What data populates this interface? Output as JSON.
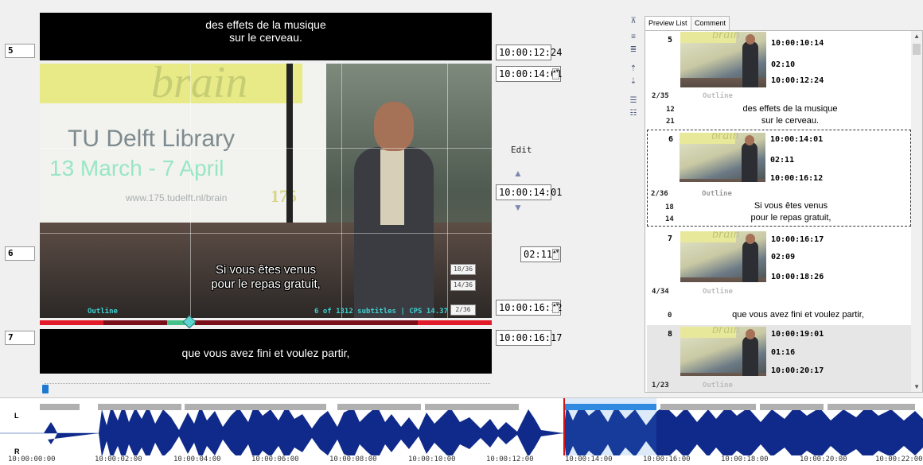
{
  "editor": {
    "prev": {
      "number": "5",
      "line1": "des effets de la musique",
      "line2": "sur le cerveau.",
      "end": "10:00:12:24"
    },
    "current": {
      "number": "6",
      "start": "10:00:14:01",
      "start_mid": "10:00:14:01",
      "duration": "02:11",
      "end": "10:00:16:12",
      "line1": "Si vous êtes venus",
      "line2": "pour le repas gratuit,"
    },
    "next": {
      "number": "7",
      "line1": "que vous avez fini et voulez partir,",
      "start": "10:00:16:17"
    },
    "edit_label": "Edit",
    "arrow_up": "▲",
    "arrow_down": "▼"
  },
  "video": {
    "slide_brain": "brain",
    "slide_library": "TU Delft Library",
    "slide_dates": "13 March - 7 April",
    "slide_url": "www.175.tudelft.nl/brain",
    "slide_logo": "175",
    "badge1": "18/36",
    "badge2": "14/36",
    "badge3": "2/36",
    "status_outline": "Outline",
    "status_count": "6 of 1312 subtitles | CPS 14.37"
  },
  "right_panel": {
    "tabs": [
      "Preview List",
      "Comment"
    ],
    "items": [
      {
        "number": "5",
        "start": "10:00:10:14",
        "duration": "02:10",
        "end": "10:00:12:24",
        "ratio": "2/35",
        "outline": "Outline",
        "c1": "12",
        "c2": "21",
        "line1": "des effets de la musique",
        "line2": "sur le cerveau."
      },
      {
        "number": "6",
        "start": "10:00:14:01",
        "duration": "02:11",
        "end": "10:00:16:12",
        "ratio": "2/36",
        "outline": "Outline",
        "c1": "18",
        "c2": "14",
        "line1": "Si vous êtes venus",
        "line2": "pour le repas gratuit,"
      },
      {
        "number": "7",
        "start": "10:00:16:17",
        "duration": "02:09",
        "end": "10:00:18:26",
        "ratio": "4/34",
        "outline": "Outline",
        "c1": "0",
        "c2": "",
        "line1": "que vous avez fini et voulez partir,",
        "line2": ""
      },
      {
        "number": "8",
        "start": "10:00:19:01",
        "duration": "01:16",
        "end": "10:00:20:17",
        "ratio": "1/23",
        "outline": "Outline",
        "c1": "",
        "c2": "",
        "line1": "",
        "line2": ""
      }
    ]
  },
  "waveform": {
    "channel_left": "L",
    "channel_right": "R",
    "ticks": [
      "10:00:00:00",
      "10:00:02:00",
      "10:00:04:00",
      "10:00:06:00",
      "10:00:08:00",
      "10:00:10:00",
      "10:00:12:00",
      "10:00:14:00",
      "10:00:16:00",
      "10:00:18:00",
      "10:00:20:00",
      "10:00:22:00"
    ]
  }
}
